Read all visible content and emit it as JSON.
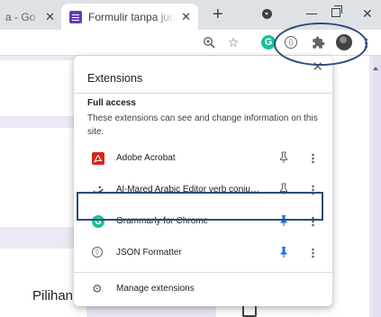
{
  "tabs": [
    {
      "label": "a - Go",
      "close": "✕"
    },
    {
      "label": "Formulir tanpa judul",
      "close": "✕"
    }
  ],
  "new_tab_symbol": "+",
  "window_close_symbol": "✕",
  "extensions_popup": {
    "title": "Extensions",
    "close_symbol": "✕",
    "section_header": "Full access",
    "section_description": "These extensions can see and change information on this site.",
    "items": [
      {
        "name": "Adobe Acrobat",
        "icon": "adobe-acrobat-icon",
        "pinned": false
      },
      {
        "name": "Al-Mared Arabic Editor verb conjugator",
        "icon": "al-mared-icon",
        "pinned": false,
        "highlighted": true
      },
      {
        "name": "Grammarly for Chrome",
        "icon": "grammarly-icon",
        "pinned": true
      },
      {
        "name": "JSON Formatter",
        "icon": "json-formatter-icon",
        "pinned": true
      }
    ],
    "manage_label": "Manage extensions"
  },
  "page": {
    "pilihan_text": "Pilihan ga"
  },
  "colors": {
    "highlight": "#2c4a7c",
    "pin_active": "#1a73e8",
    "pin_inactive": "#5f6368",
    "forms_purple": "#673ab7",
    "grammarly_green": "#15c39a",
    "acrobat_red": "#d7261a"
  }
}
